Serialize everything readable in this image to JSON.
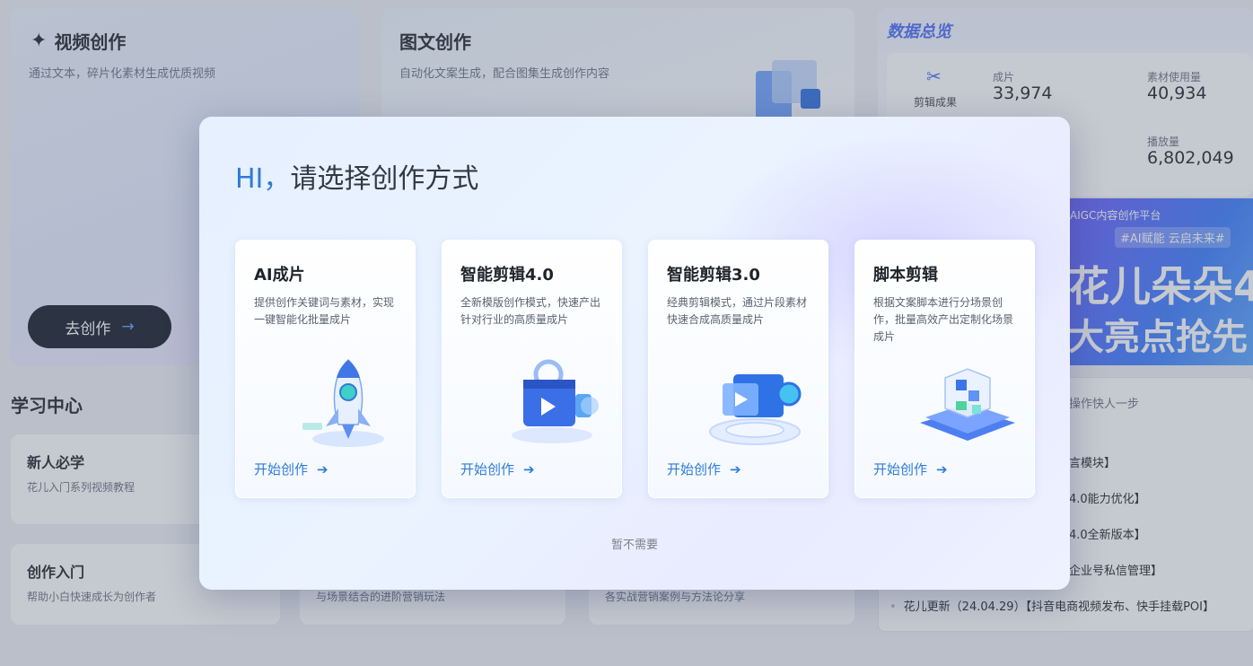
{
  "background": {
    "video": {
      "title": "视频创作",
      "desc": "通过文本，碎片化素材生成优质视频",
      "cta": "去创作"
    },
    "image": {
      "title": "图文创作",
      "desc": "自动化文案生成，配合图集生成创作内容"
    },
    "learning": {
      "title": "学习中心",
      "items": [
        {
          "title": "新人必学",
          "desc": "花儿入门系列视频教程"
        },
        {
          "title": "创作入门",
          "desc": "帮助小白快速成长为创作者"
        }
      ],
      "mid_desc_1": "与场景结合的进阶营销玩法",
      "mid_desc_2": "各实战营销案例与方法论分享"
    },
    "data": {
      "title": "数据总览",
      "category": "剪辑成果",
      "stats": [
        {
          "label": "成片",
          "value": "33,974"
        },
        {
          "label": "素材使用量",
          "value": "40,934"
        },
        {
          "label": "播放量",
          "value": "6,802,049"
        }
      ]
    },
    "banner": {
      "tag": "AIGC内容创作平台",
      "badge": "#AI赋能 云启未来#",
      "line1": "花儿朵朵4",
      "line2": "大亮点抢先"
    },
    "news": {
      "header_partial": "操作快人一步",
      "items": [
        "言模块】",
        "4.0能力优化】",
        "4.0全新版本】",
        "企业号私信管理】",
        "花儿更新（24.04.29）【抖音电商视频发布、快手挂载POI】"
      ]
    }
  },
  "modal": {
    "greeting": "HI，",
    "title": "请选择创作方式",
    "skip": "暂不需要",
    "options": [
      {
        "title": "AI成片",
        "desc": "提供创作关键词与素材，实现一键智能化批量成片",
        "cta": "开始创作",
        "icon": "rocket-icon"
      },
      {
        "title": "智能剪辑4.0",
        "desc": "全新模版创作模式，快速产出针对行业的高质量成片",
        "cta": "开始创作",
        "icon": "film-camera-icon"
      },
      {
        "title": "智能剪辑3.0",
        "desc": "经典剪辑模式，通过片段素材快速合成高质量成片",
        "cta": "开始创作",
        "icon": "video-camera-icon"
      },
      {
        "title": "脚本剪辑",
        "desc": "根据文案脚本进行分场景创作，批量高效产出定制化场景成片",
        "cta": "开始创作",
        "icon": "cube-chip-icon"
      }
    ]
  },
  "colors": {
    "accent": "#2f7bd8",
    "dark_button": "#141a26"
  }
}
